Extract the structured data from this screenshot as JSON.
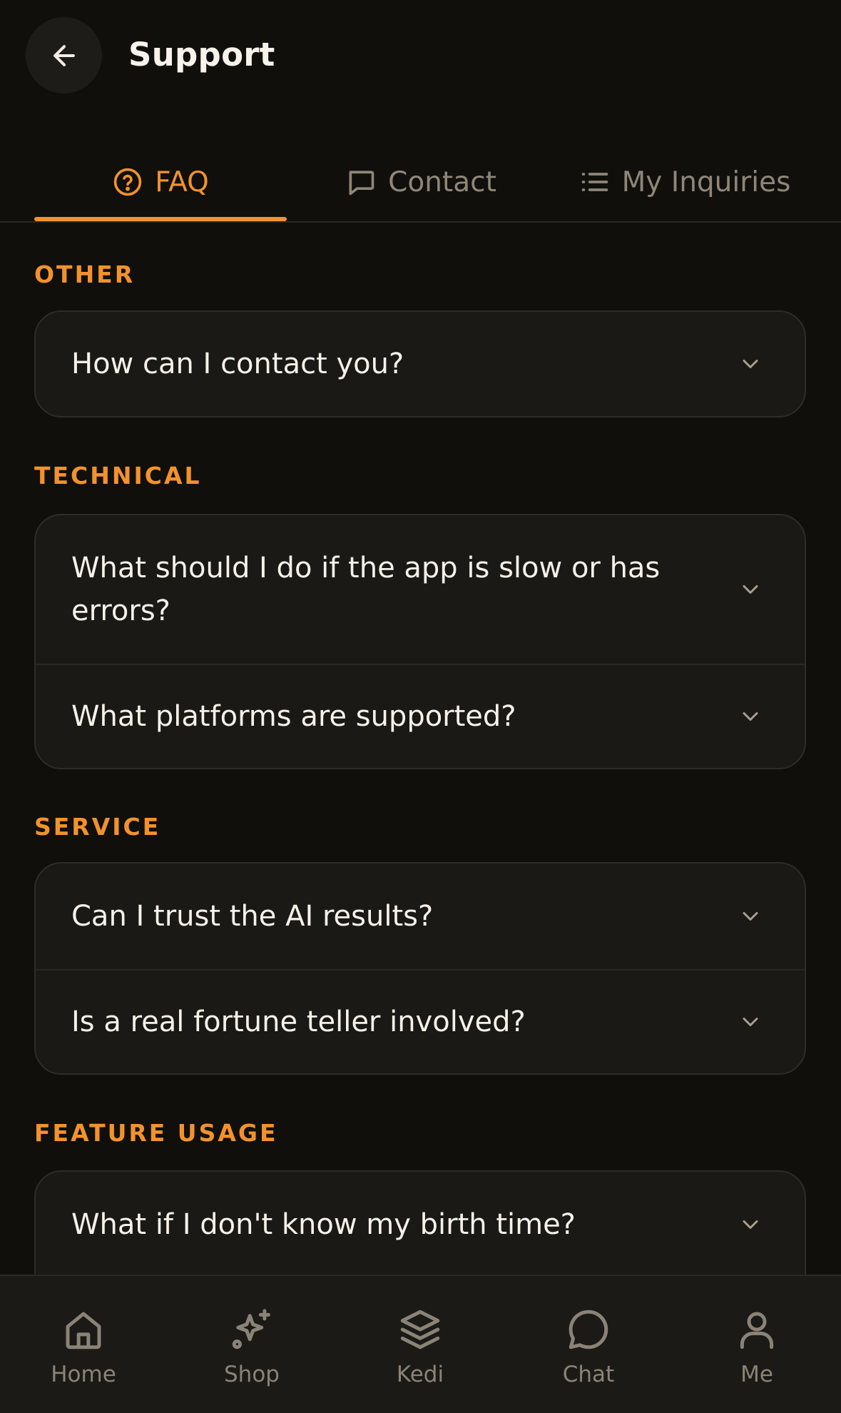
{
  "header": {
    "title": "Support"
  },
  "tabs": [
    {
      "label": "FAQ",
      "icon": "help-circle-icon",
      "active": true
    },
    {
      "label": "Contact",
      "icon": "message-square-icon",
      "active": false
    },
    {
      "label": "My Inquiries",
      "icon": "list-icon",
      "active": false
    }
  ],
  "sections": [
    {
      "title": "OTHER",
      "items": [
        "How can I contact you?"
      ]
    },
    {
      "title": "TECHNICAL",
      "items": [
        "What should I do if the app is slow or has errors?",
        "What platforms are supported?"
      ]
    },
    {
      "title": "SERVICE",
      "items": [
        "Can I trust the AI results?",
        "Is a real fortune teller involved?"
      ]
    },
    {
      "title": "FEATURE USAGE",
      "items": [
        "What if I don't know my birth time?"
      ]
    }
  ],
  "nav": [
    {
      "label": "Home",
      "icon": "home-icon"
    },
    {
      "label": "Shop",
      "icon": "sparkles-icon"
    },
    {
      "label": "Kedi",
      "icon": "layers-icon"
    },
    {
      "label": "Chat",
      "icon": "chat-bubble-icon"
    },
    {
      "label": "Me",
      "icon": "user-icon"
    }
  ],
  "colors": {
    "accent": "#f2922c",
    "background": "#100f0c",
    "card": "#1a1916",
    "muted": "#8b8377"
  }
}
